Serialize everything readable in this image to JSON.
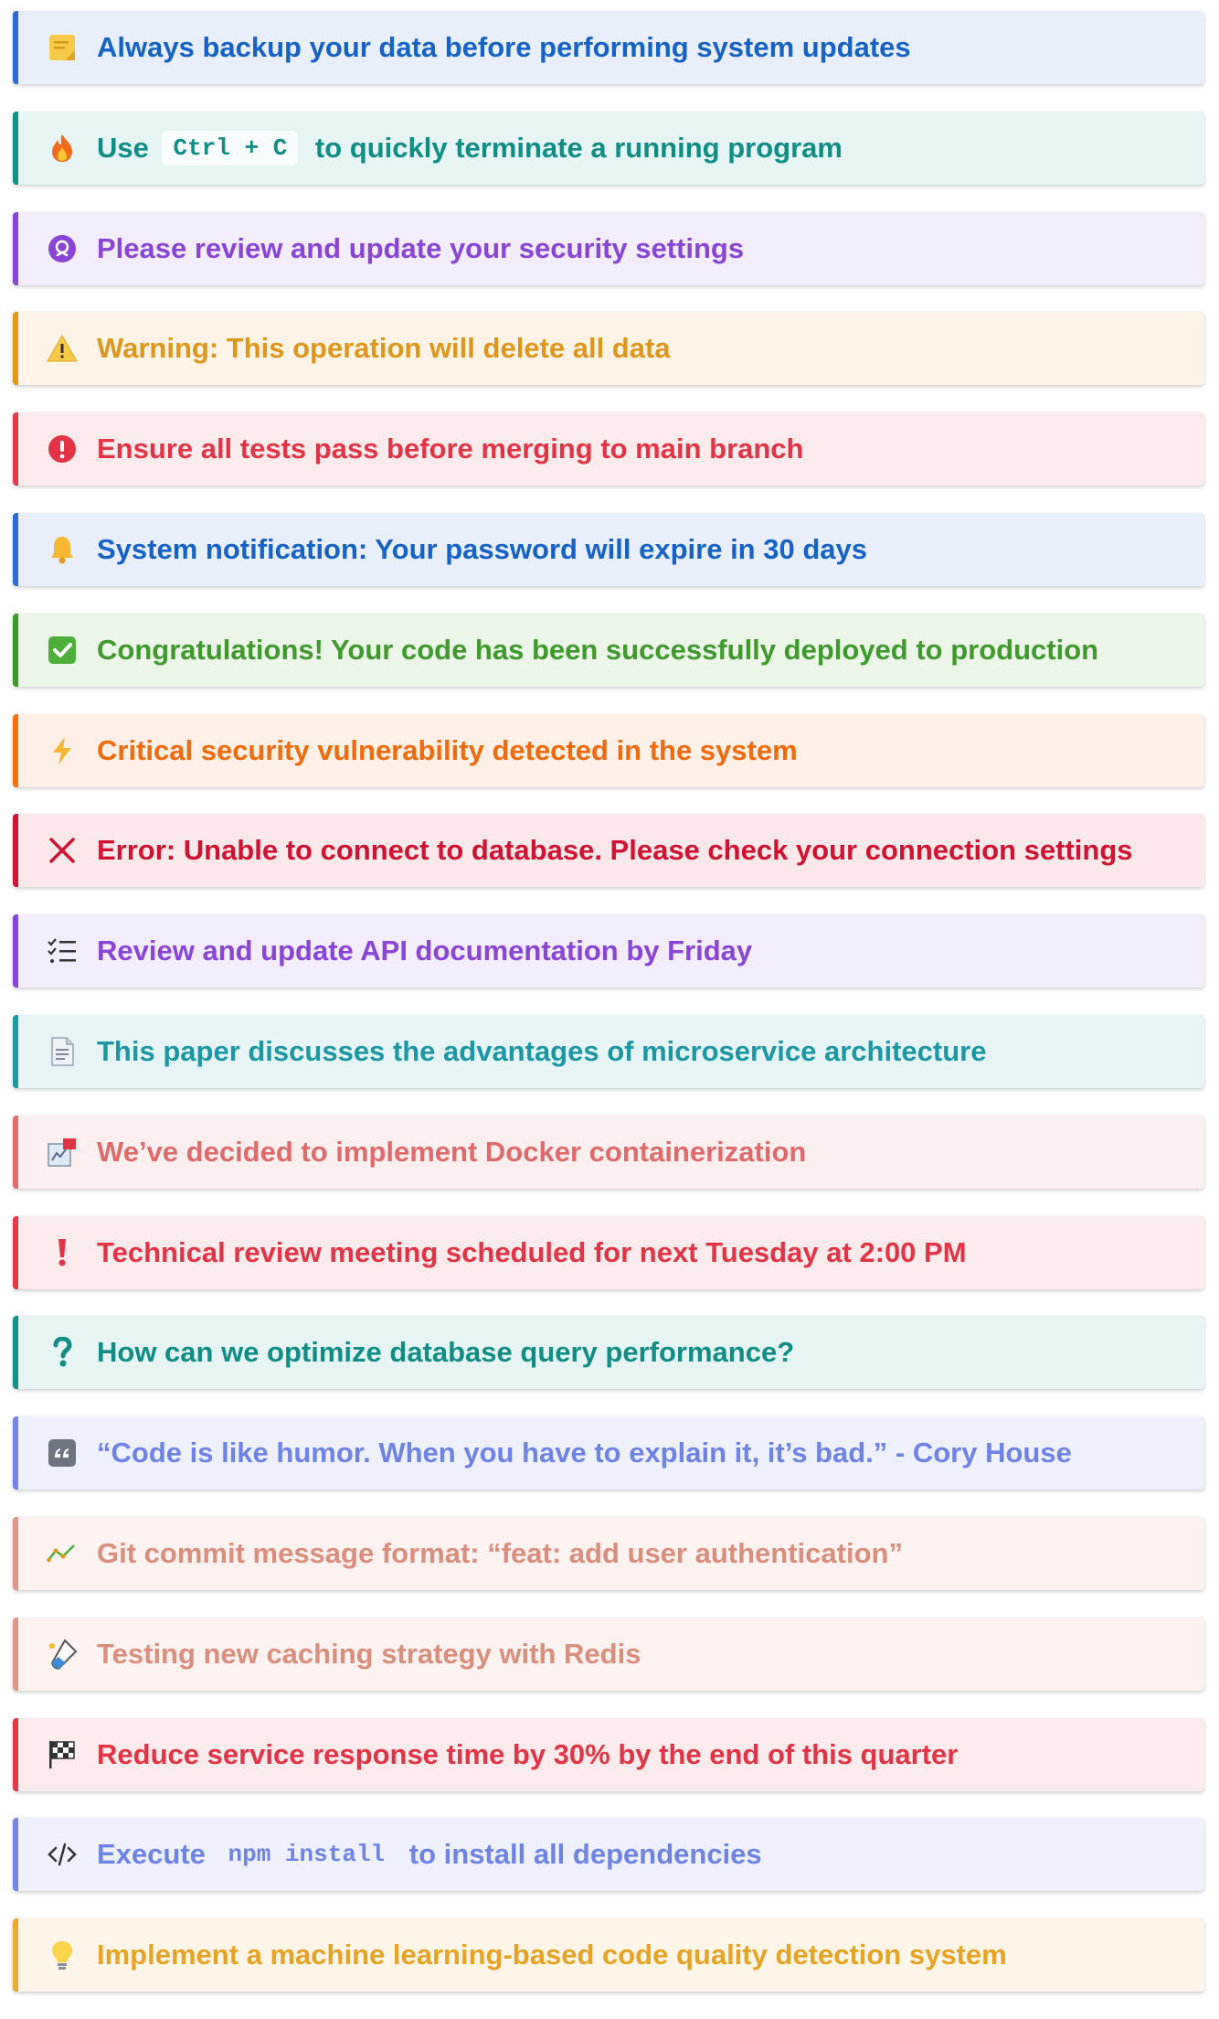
{
  "callouts": [
    {
      "kind": "note",
      "icon": "memo-icon",
      "border": "#2b6fd6",
      "bg": "#e8effb",
      "color": "#1662c7",
      "parts": [
        {
          "t": "text",
          "v": "Always backup your data before performing system updates"
        }
      ]
    },
    {
      "kind": "tip",
      "icon": "fire-icon",
      "border": "#14918a",
      "bg": "#e6f4f3",
      "color": "#0f8d86",
      "parts": [
        {
          "t": "text",
          "v": "Use "
        },
        {
          "t": "code",
          "v": "Ctrl + C"
        },
        {
          "t": "text",
          "v": " to quickly terminate a running program"
        }
      ]
    },
    {
      "kind": "important",
      "icon": "shield-icon",
      "border": "#8a44da",
      "bg": "#f2ecfb",
      "color": "#8b45d6",
      "parts": [
        {
          "t": "text",
          "v": "Please review and update your security settings"
        }
      ]
    },
    {
      "kind": "warning",
      "icon": "warning-icon",
      "border": "#e39a1b",
      "bg": "#fdf4e7",
      "color": "#e0961a",
      "parts": [
        {
          "t": "text",
          "v": "Warning: This operation will delete all data"
        }
      ]
    },
    {
      "kind": "caution",
      "icon": "exclamation-circle-icon",
      "border": "#e3394a",
      "bg": "#fcebec",
      "color": "#e23445",
      "parts": [
        {
          "t": "text",
          "v": "Ensure all tests pass before merging to main branch"
        }
      ]
    },
    {
      "kind": "notification",
      "icon": "bell-icon",
      "border": "#2b6fd6",
      "bg": "#e8effb",
      "color": "#1662c7",
      "parts": [
        {
          "t": "text",
          "v": "System notification: Your password will expire in 30 days"
        }
      ]
    },
    {
      "kind": "success",
      "icon": "check-box-icon",
      "border": "#3c9a2a",
      "bg": "#ebf5e8",
      "color": "#3e9a2c",
      "parts": [
        {
          "t": "text",
          "v": "Congratulations! Your code has been successfully deployed to production"
        }
      ]
    },
    {
      "kind": "danger",
      "icon": "lightning-icon",
      "border": "#f5700f",
      "bg": "#fef0e6",
      "color": "#f06a0e",
      "parts": [
        {
          "t": "text",
          "v": "Critical security vulnerability detected in the system"
        }
      ]
    },
    {
      "kind": "error",
      "icon": "cross-icon",
      "border": "#d11432",
      "bg": "#fbe8eb",
      "color": "#cf1330",
      "parts": [
        {
          "t": "text",
          "v": "Error: Unable to connect to database. Please check your connection settings"
        }
      ]
    },
    {
      "kind": "todo",
      "icon": "checklist-icon",
      "border": "#8a44da",
      "bg": "#f2ecfb",
      "color": "#8b45d6",
      "parts": [
        {
          "t": "text",
          "v": "Review and update API documentation by Friday"
        }
      ]
    },
    {
      "kind": "abstract",
      "icon": "document-icon",
      "border": "#1f98a6",
      "bg": "#e6f4f5",
      "color": "#1b97a5",
      "parts": [
        {
          "t": "text",
          "v": "This paper discusses the advantages of microservice architecture"
        }
      ]
    },
    {
      "kind": "decision",
      "icon": "flowchart-icon",
      "border": "#e26d6d",
      "bg": "#fcefef",
      "color": "#e06a6a",
      "parts": [
        {
          "t": "text",
          "v": "We’ve decided to implement Docker containerization"
        }
      ]
    },
    {
      "kind": "attention",
      "icon": "exclamation-icon",
      "border": "#e3394a",
      "bg": "#fcebec",
      "color": "#e23445",
      "parts": [
        {
          "t": "text",
          "v": "Technical review meeting scheduled for next Tuesday at 2:00 PM"
        }
      ]
    },
    {
      "kind": "question",
      "icon": "question-icon",
      "border": "#14918a",
      "bg": "#e6f4f3",
      "color": "#0f8d86",
      "parts": [
        {
          "t": "text",
          "v": "How can we optimize database query performance?"
        }
      ]
    },
    {
      "kind": "quote",
      "icon": "quote-icon",
      "border": "#7186e8",
      "bg": "#eef1fc",
      "color": "#6e83e6",
      "parts": [
        {
          "t": "text",
          "v": "“Code is like humor. When you have to explain it, it’s bad.” - Cory House"
        }
      ]
    },
    {
      "kind": "example",
      "icon": "trend-icon",
      "border": "#e39585",
      "bg": "#fcf2f0",
      "color": "#dc8e7d",
      "parts": [
        {
          "t": "text",
          "v": "Git commit message format: “feat: add user authentication”"
        }
      ]
    },
    {
      "kind": "experiment",
      "icon": "test-tube-icon",
      "border": "#e39585",
      "bg": "#fcf2f0",
      "color": "#dc8e7d",
      "parts": [
        {
          "t": "text",
          "v": "Testing new caching strategy with Redis"
        }
      ]
    },
    {
      "kind": "goal",
      "icon": "checkered-flag-icon",
      "border": "#e3394a",
      "bg": "#fcebec",
      "color": "#e23445",
      "parts": [
        {
          "t": "text",
          "v": "Reduce service response time by 30% by the end of this quarter"
        }
      ]
    },
    {
      "kind": "code",
      "icon": "code-icon",
      "border": "#7186e8",
      "bg": "#eef1fc",
      "color": "#6e83e6",
      "parts": [
        {
          "t": "text",
          "v": "Execute "
        },
        {
          "t": "codeplain",
          "v": "npm install"
        },
        {
          "t": "text",
          "v": " to install all dependencies"
        }
      ]
    },
    {
      "kind": "idea",
      "icon": "lightbulb-icon",
      "border": "#eba935",
      "bg": "#fdf5e8",
      "color": "#e8a324",
      "parts": [
        {
          "t": "text",
          "v": "Implement a machine learning-based code quality detection system"
        }
      ]
    }
  ]
}
